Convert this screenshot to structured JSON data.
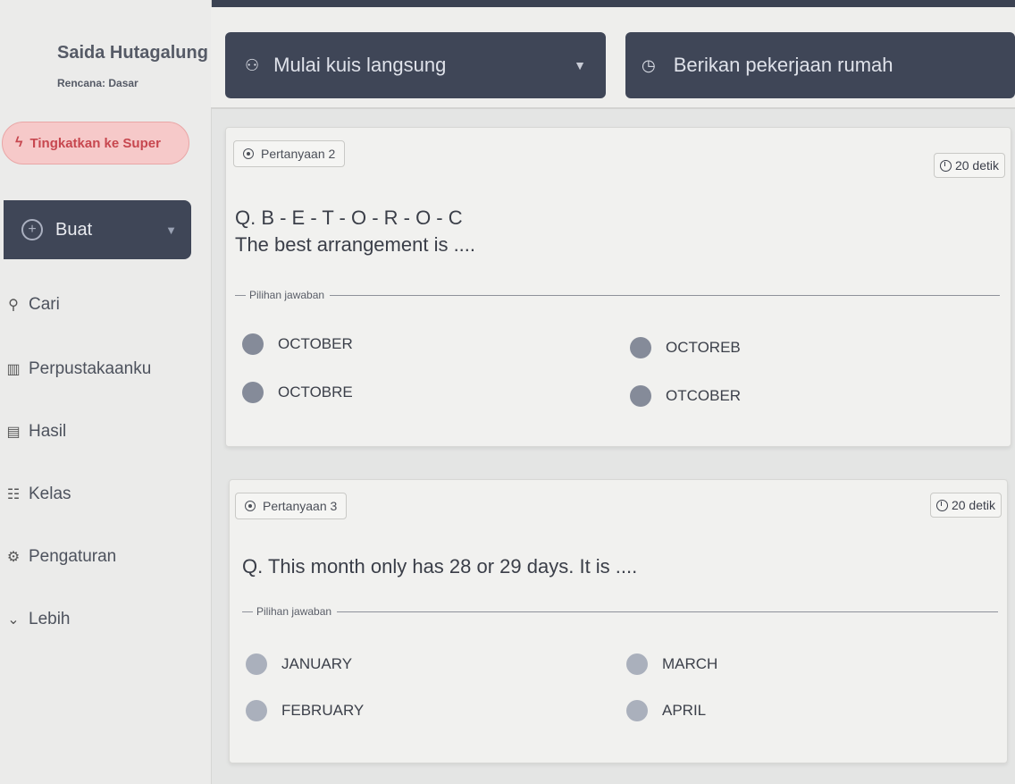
{
  "sidebar": {
    "user_name": "Saida Hutagalung",
    "plan": "Rencana: Dasar",
    "upgrade_label": "Tingkatkan ke Super",
    "create_label": "Buat",
    "nav": [
      {
        "label": "Cari",
        "icon": "search-icon"
      },
      {
        "label": "Perpustakaanku",
        "icon": "library-icon"
      },
      {
        "label": "Hasil",
        "icon": "results-icon"
      },
      {
        "label": "Kelas",
        "icon": "class-icon"
      },
      {
        "label": "Pengaturan",
        "icon": "gear-icon"
      },
      {
        "label": "Lebih",
        "icon": "chevron-down-icon"
      }
    ]
  },
  "actions": {
    "live_quiz_label": "Mulai kuis langsung",
    "homework_label": "Berikan pekerjaan rumah"
  },
  "questions": [
    {
      "label": "Pertanyaan 2",
      "timer": "20 detik",
      "line1": "Q. B - E - T - O - R - O - C",
      "line2": "The best arrangement is ....",
      "choices_legend": "Pilihan jawaban",
      "choices": [
        "OCTOBER",
        "OCTOREB",
        "OCTOBRE",
        "OTCOBER"
      ]
    },
    {
      "label": "Pertanyaan 3",
      "timer": "20 detik",
      "line1": "Q. This month only has 28 or 29 days. It is ....",
      "choices_legend": "Pilihan jawaban",
      "choices": [
        "JANUARY",
        "MARCH",
        "FEBRUARY",
        "APRIL"
      ]
    }
  ],
  "colors": {
    "dark_button": "#3f4657",
    "upgrade_bg": "#f6c9c9",
    "upgrade_text": "#c7474f"
  }
}
